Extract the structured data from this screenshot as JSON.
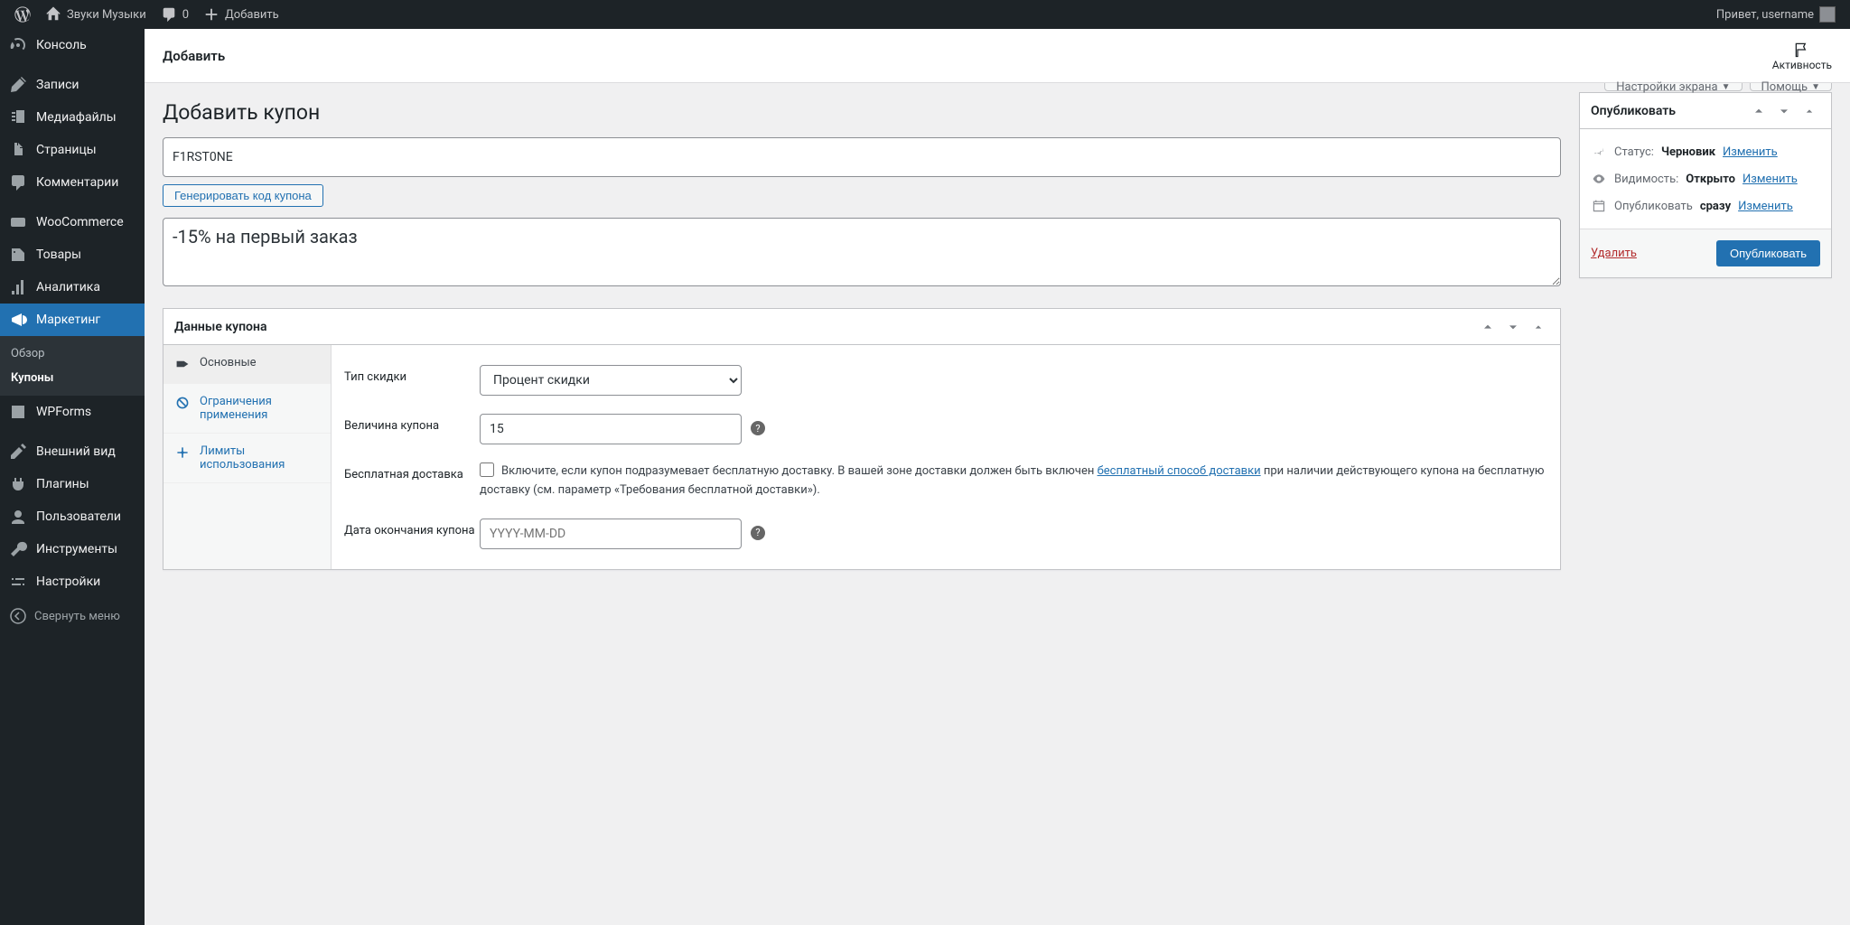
{
  "adminbar": {
    "site_name": "Звуки Музыки",
    "comments_count": "0",
    "add_new": "Добавить",
    "howdy": "Привет, username"
  },
  "sidebar": {
    "items": [
      {
        "label": "Консоль"
      },
      {
        "label": "Записи"
      },
      {
        "label": "Медиафайлы"
      },
      {
        "label": "Страницы"
      },
      {
        "label": "Комментарии"
      },
      {
        "label": "WooCommerce"
      },
      {
        "label": "Товары"
      },
      {
        "label": "Аналитика"
      },
      {
        "label": "Маркетинг"
      },
      {
        "label": "WPForms"
      },
      {
        "label": "Внешний вид"
      },
      {
        "label": "Плагины"
      },
      {
        "label": "Пользователи"
      },
      {
        "label": "Инструменты"
      },
      {
        "label": "Настройки"
      }
    ],
    "marketing_sub": [
      {
        "label": "Обзор"
      },
      {
        "label": "Купоны"
      }
    ],
    "collapse": "Свернуть меню"
  },
  "titlebar": {
    "title": "Добавить",
    "activity": "Активность"
  },
  "toptabs": {
    "screen_options": "Настройки экрана",
    "help": "Помощь"
  },
  "page": {
    "heading": "Добавить купон",
    "code_value": "F1RST0NE",
    "generate_btn": "Генерировать код купона",
    "description_value": "-15% на первый заказ"
  },
  "coupon_data": {
    "title": "Данные купона",
    "tabs": {
      "general": "Основные",
      "restriction": "Ограничения применения",
      "limits": "Лимиты использования"
    },
    "fields": {
      "discount_type_label": "Тип скидки",
      "discount_type_value": "Процент скидки",
      "amount_label": "Величина купона",
      "amount_value": "15",
      "free_shipping_label": "Бесплатная доставка",
      "free_shipping_text_before": "Включите, если купон подразумевает бесплатную доставку. В вашей зоне доставки должен быть включен ",
      "free_shipping_link": "бесплатный способ доставки",
      "free_shipping_text_after": " при наличии действующего купона на бесплатную доставку (см. параметр «Требования бесплатной доставки»).",
      "expiry_label": "Дата окончания купона",
      "expiry_placeholder": "YYYY-MM-DD"
    }
  },
  "publish": {
    "title": "Опубликовать",
    "status_label": "Статус:",
    "status_value": "Черновик",
    "visibility_label": "Видимость:",
    "visibility_value": "Открыто",
    "schedule_label": "Опубликовать",
    "schedule_value": "сразу",
    "edit": "Изменить",
    "delete": "Удалить",
    "publish_btn": "Опубликовать"
  }
}
